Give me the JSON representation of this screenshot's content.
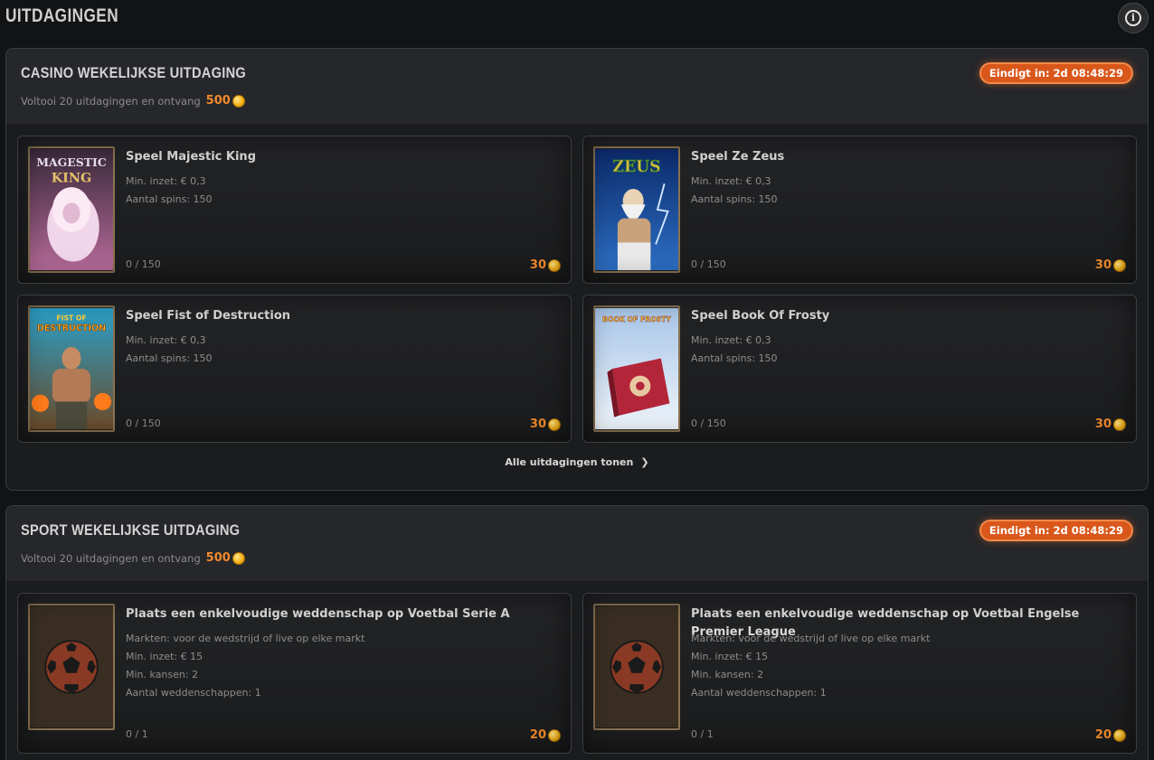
{
  "page": {
    "title": "UITDAGINGEN"
  },
  "colors": {
    "accent": "#f08a2c",
    "timer_bg": "#d9571b",
    "background": "#121314"
  },
  "sections": [
    {
      "title": "CASINO WEKELIJKSE UITDAGING",
      "subtitle": "Voltooi 20 uitdagingen en ontvang",
      "reward": "500",
      "timer": "Eindigt in: 2d 08:48:29",
      "show_all": "Alle uitdagingen tonen",
      "cards": [
        {
          "title": "Speel Majestic King",
          "lines": [
            "Min. inzet: € 0,3",
            "Aantal spins: 150"
          ],
          "progress": "0 / 150",
          "points": "30",
          "thumb_icon": "lion-icon",
          "thumb_text": [
            "MAGESTIC",
            "KING"
          ]
        },
        {
          "title": "Speel Ze Zeus",
          "lines": [
            "Min. inzet: € 0,3",
            "Aantal spins: 150"
          ],
          "progress": "0 / 150",
          "points": "30",
          "thumb_icon": "zeus-icon",
          "thumb_text": [
            "ZEUS"
          ]
        },
        {
          "title": "Speel Fist of Destruction",
          "lines": [
            "Min. inzet: € 0,3",
            "Aantal spins: 150"
          ],
          "progress": "0 / 150",
          "points": "30",
          "thumb_icon": "fighter-icon",
          "thumb_text": [
            "FIST OF",
            "DESTRUCTION"
          ]
        },
        {
          "title": "Speel Book Of Frosty",
          "lines": [
            "Min. inzet: € 0,3",
            "Aantal spins: 150"
          ],
          "progress": "0 / 150",
          "points": "30",
          "thumb_icon": "book-icon",
          "thumb_text": [
            "BOOK OF FROSTY"
          ]
        }
      ]
    },
    {
      "title": "SPORT WEKELIJKSE UITDAGING",
      "subtitle": "Voltooi 20 uitdagingen en ontvang",
      "reward": "500",
      "timer": "Eindigt in: 2d 08:48:29",
      "cards": [
        {
          "title": "Plaats een enkelvoudige weddenschap op Voetbal Serie A",
          "lines": [
            "Markten: voor de wedstrijd of live op elke markt",
            "Min. inzet: € 15",
            "Min. kansen: 2",
            "Aantal weddenschappen: 1"
          ],
          "progress": "0 / 1",
          "points": "20",
          "thumb_icon": "football-icon"
        },
        {
          "title": "Plaats een enkelvoudige weddenschap op Voetbal Engelse Premier League",
          "lines": [
            "Markten: voor de wedstrijd of live op elke markt",
            "Min. inzet: € 15",
            "Min. kansen: 2",
            "Aantal weddenschappen: 1"
          ],
          "progress": "0 / 1",
          "points": "20",
          "thumb_icon": "football-icon"
        }
      ]
    }
  ]
}
